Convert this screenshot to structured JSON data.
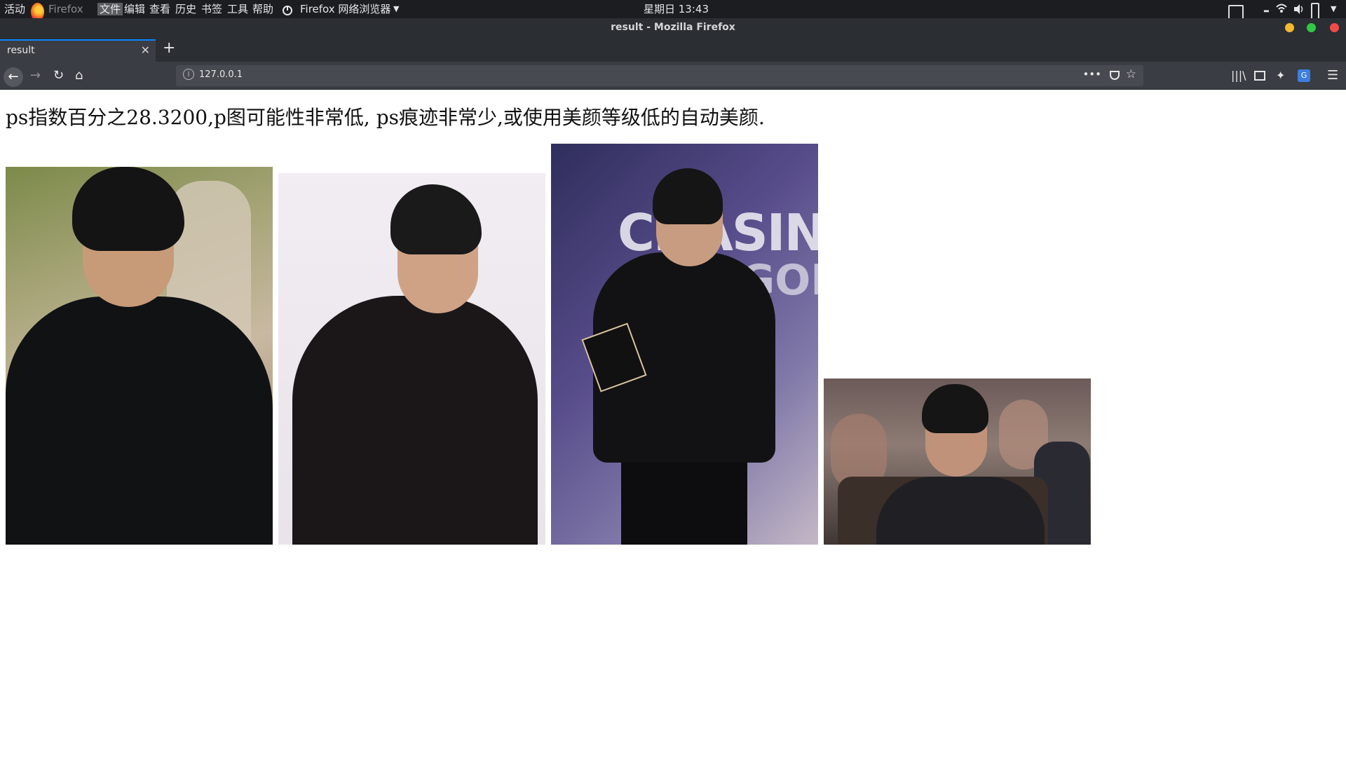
{
  "topbar": {
    "activities": "活动",
    "app_short": "Firefox",
    "menu": [
      "文件",
      "编辑",
      "查看",
      "历史",
      "书签",
      "工具",
      "帮助"
    ],
    "app_name": "Firefox 网络浏览器",
    "clock": "星期日 13:43"
  },
  "window": {
    "title": "result - Mozilla Firefox"
  },
  "tabs": [
    {
      "label": "result",
      "active": true
    }
  ],
  "navbar": {
    "url": "127.0.0.1"
  },
  "page": {
    "headline": "ps指数百分之28.3200,p图可能性非常低, ps痕迹非常少,或使用美颜等级低的自动美颜.",
    "photos": [
      {
        "name": "photo-1"
      },
      {
        "name": "photo-2"
      },
      {
        "name": "photo-3",
        "poster_text": "CHASING",
        "poster_text2": "GON"
      },
      {
        "name": "photo-4"
      }
    ]
  },
  "colors": {
    "topbar_bg": "#1b1d21",
    "titlebar_bg": "#2b2e33",
    "toolbar_bg": "#3a3d43",
    "urlbar_bg": "#474a50",
    "tab_accent": "#0a84ff"
  }
}
